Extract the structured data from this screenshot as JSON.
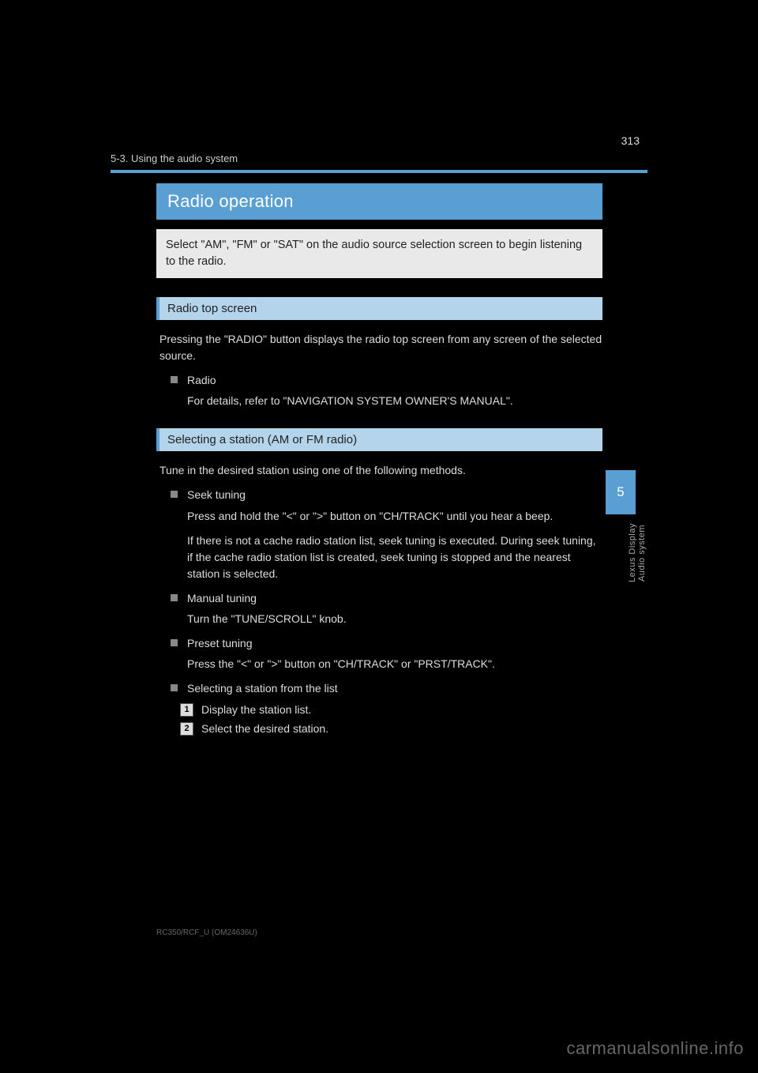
{
  "page_number_top": "313",
  "header_line": "5-3. Using the audio system",
  "title": "Radio operation",
  "intro": "Select \"AM\", \"FM\" or \"SAT\" on the audio source selection screen to begin listening to the radio.",
  "section1": {
    "heading": "Radio top screen",
    "body": "Pressing the \"RADIO\" button displays the radio top screen from any screen of the selected source.",
    "sub": {
      "label": "Radio",
      "text": "For details, refer to \"NAVIGATION SYSTEM OWNER'S MANUAL\"."
    }
  },
  "section2": {
    "heading": "Selecting a station (AM or FM radio)",
    "items": [
      {
        "label": "Seek tuning",
        "text": "Press and hold the \"<\" or \">\" button on \"CH/TRACK\" until you hear a beep.",
        "extra": "If there is not a cache radio station list, seek tuning is executed. During seek tuning, if the cache radio station list is created, seek tuning is stopped and the nearest station is selected."
      },
      {
        "label": "Manual tuning",
        "text": "Turn the \"TUNE/SCROLL\" knob."
      },
      {
        "label": "Preset tuning",
        "text": "Press the \"<\" or \">\" button on \"CH/TRACK\" or \"PRST/TRACK\"."
      },
      {
        "label": "Selecting a station from the list",
        "steps": [
          "Display the station list.",
          "Select the desired station."
        ]
      }
    ]
  },
  "side_tab": "5",
  "side_label": "Lexus Display Audio system",
  "footer_small": "RC350/RCF_U (OM24636U)",
  "watermark": "carmanualsonline.info"
}
